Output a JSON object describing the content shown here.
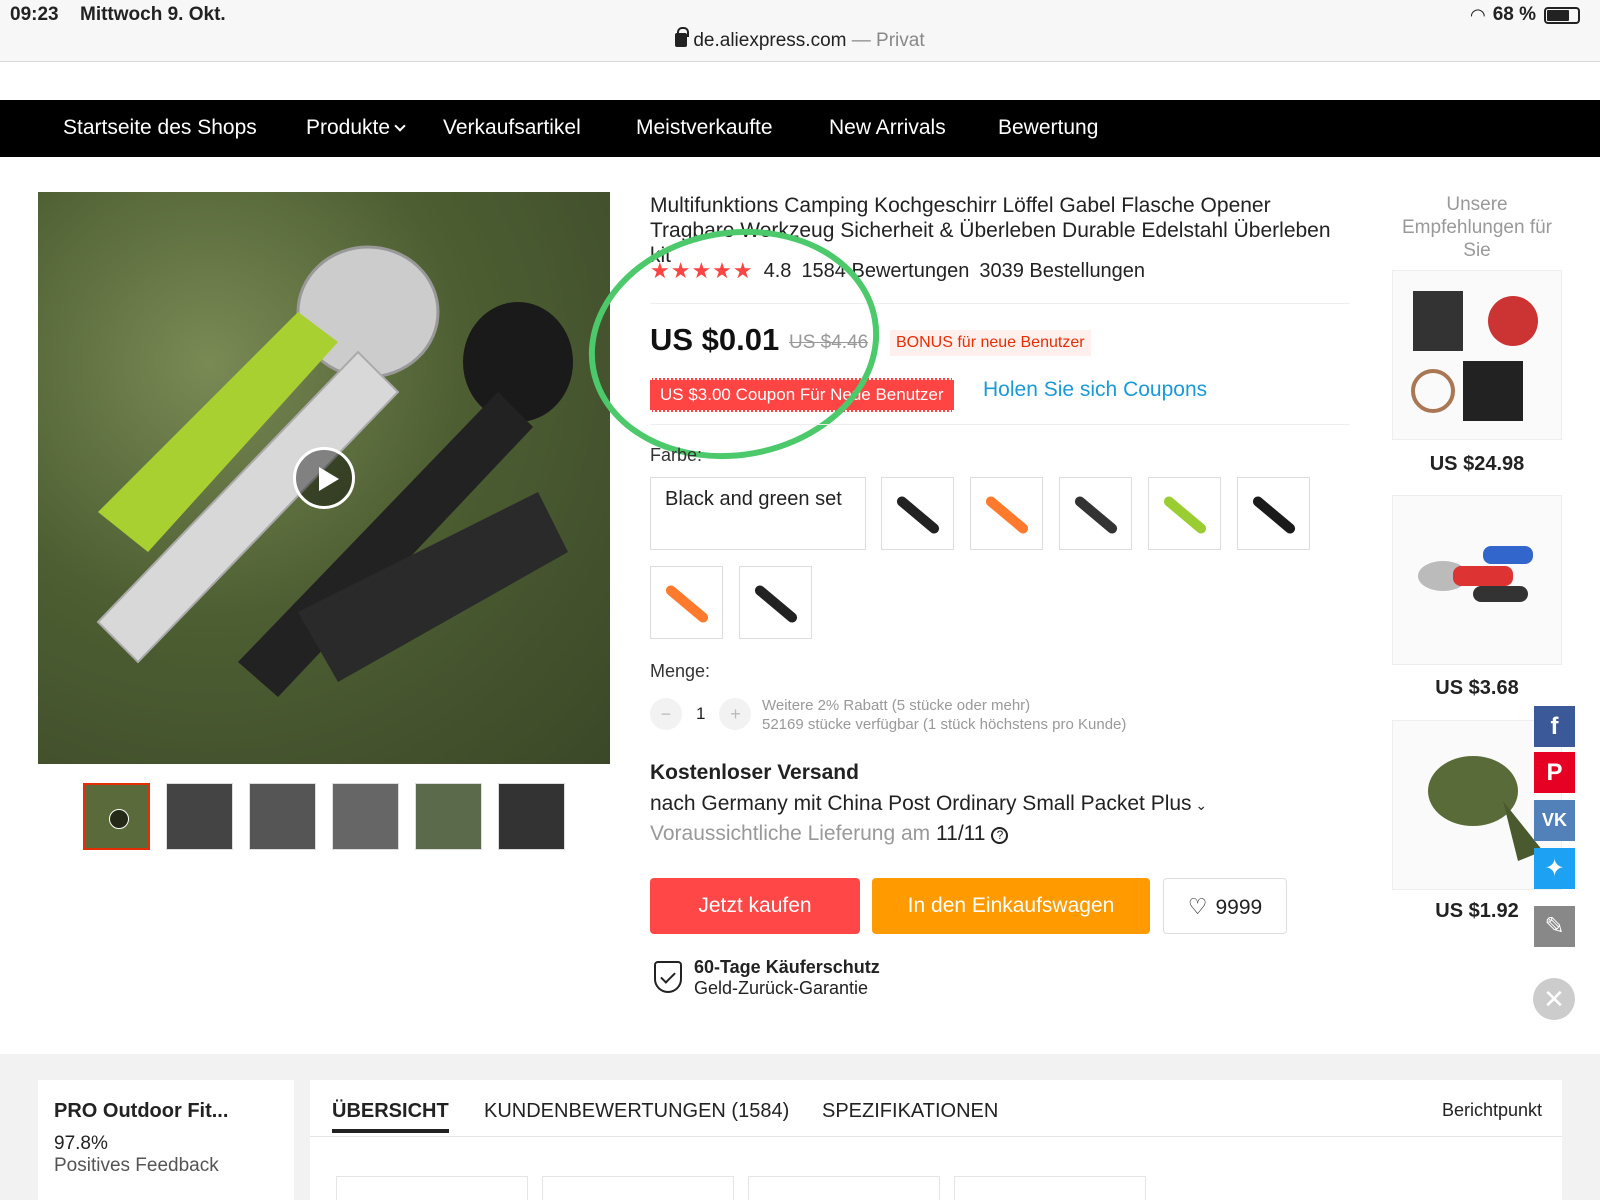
{
  "status": {
    "time": "09:23",
    "date": "Mittwoch 9. Okt.",
    "battery": "68 %",
    "url": "de.aliexpress.com",
    "url_suffix": "— Privat"
  },
  "nav": {
    "items": [
      "Startseite des Shops",
      "Produkte",
      "Verkaufsartikel",
      "Meistverkaufte",
      "New Arrivals",
      "Bewertung"
    ]
  },
  "product": {
    "title": "Multifunktions Camping Kochgeschirr Löffel Gabel Flasche Opener Tragbare Werkzeug Sicherheit & Überleben Durable Edelstahl Überleben kit",
    "rating": "4.8",
    "reviews": "1584 Bewertungen",
    "orders": "3039 Bestellungen",
    "price": "US $0.01",
    "old_price": "US $4.46",
    "bonus": "BONUS für neue Benutzer",
    "coupon": "US $3.00 Coupon Für Neue Benutzer",
    "get_coupons": "Holen Sie sich Coupons",
    "color_label": "Farbe:",
    "color_option_text": "Black and green set",
    "quantity_label": "Menge:",
    "quantity_value": "1",
    "quantity_discount": "Weitere 2% Rabatt (5 stücke oder mehr)",
    "quantity_stock": "52169 stücke verfügbar (1 stück höchstens pro Kunde)",
    "shipping_title": "Kostenloser Versand",
    "shipping_line": "nach Germany mit China Post Ordinary Small Packet Plus",
    "delivery_prefix": "Voraussichtliche Lieferung am",
    "delivery_date": "11/11",
    "buy_now": "Jetzt kaufen",
    "add_to_cart": "In den Einkaufswagen",
    "wishlist_count": "9999",
    "protection_title": "60-Tage Käuferschutz",
    "protection_sub": "Geld-Zurück-Garantie",
    "sku_colors": [
      "#222",
      "#ff7a2d",
      "#333",
      "#9acd32",
      "#1a1a1a",
      "#ff7a2d",
      "#222"
    ]
  },
  "recommendations": {
    "heading": "Unsere Empfehlungen für Sie",
    "prices": [
      "US $24.98",
      "US $3.68",
      "US $1.92"
    ]
  },
  "share": {
    "icons": [
      "facebook-icon",
      "pinterest-icon",
      "vk-icon",
      "twitter-icon",
      "edit-icon"
    ]
  },
  "bottom": {
    "store_name": "PRO Outdoor Fit...",
    "feedback_pct": "97.8%",
    "feedback_label": "Positives Feedback",
    "tabs": [
      "ÜBERSICHT",
      "KUNDENBEWERTUNGEN (1584)",
      "SPEZIFIKATIONEN"
    ],
    "report": "Berichtpunkt"
  },
  "colors": {
    "accent_red": "#ff4747",
    "accent_orange": "#ff9a00",
    "link_blue": "#1a9ad6",
    "annotation_green": "#4cc96a"
  }
}
